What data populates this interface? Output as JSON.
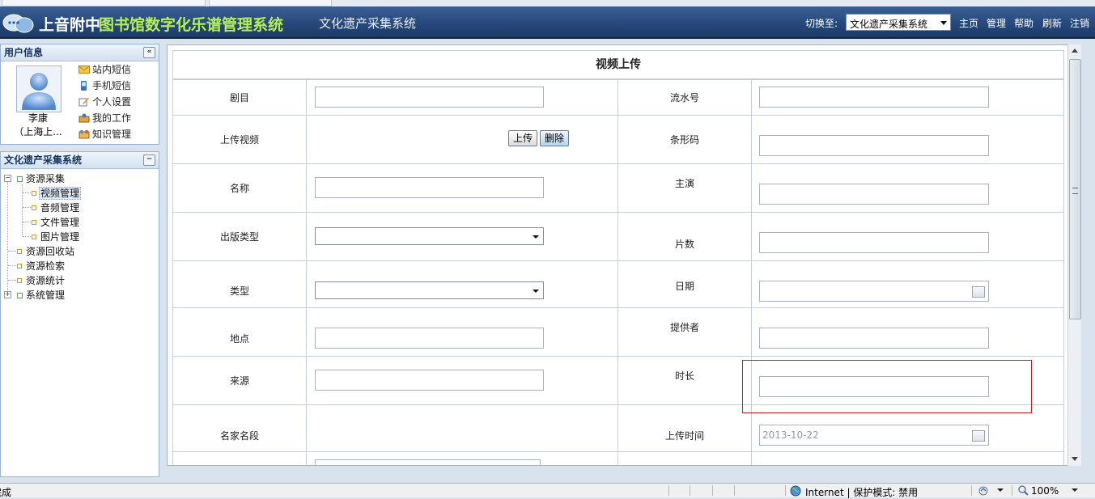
{
  "header": {
    "title_part1": "上音附中",
    "title_part2": "图书馆数字化乐谱管理系统",
    "subsystem": "文化遗产采集系统",
    "switch_label": "切换至:",
    "switch_value": "文化遗产采集系统",
    "links": [
      "主页",
      "管理",
      "帮助",
      "刷新",
      "注销"
    ]
  },
  "user_panel": {
    "title": "用户信息",
    "name": "李康",
    "org": "（上海上...",
    "menu": [
      "站内短信",
      "手机短信",
      "个人设置",
      "我的工作",
      "知识管理"
    ]
  },
  "nav_panel": {
    "title": "文化遗产采集系统",
    "tree": {
      "resource_collect": "资源采集",
      "video_manage": "视频管理",
      "audio_manage": "音频管理",
      "file_manage": "文件管理",
      "image_manage": "图片管理",
      "recycle": "资源回收站",
      "search": "资源检索",
      "stats": "资源统计",
      "system": "系统管理"
    }
  },
  "form": {
    "title": "视频上传",
    "labels": {
      "play": "剧目",
      "serial": "流水号",
      "upload_video": "上传视频",
      "barcode": "条形码",
      "name": "名称",
      "lead_actor": "主演",
      "publish_type": "出版类型",
      "episodes": "片数",
      "type": "类型",
      "date": "日期",
      "location": "地点",
      "provider": "提供者",
      "source": "来源",
      "duration": "时长",
      "famous_segment": "名家名段",
      "upload_time": "上传时间"
    },
    "upload_button": "上传",
    "delete_button": "删除",
    "upload_time_value": "2013-10-22"
  },
  "statusbar": {
    "left": "完成",
    "zone": "Internet | 保护模式: 禁用",
    "zoom": "100%"
  },
  "colors": {
    "header_bg": "#27497c",
    "title_accent": "#b7f056",
    "highlight": "#d01818"
  }
}
